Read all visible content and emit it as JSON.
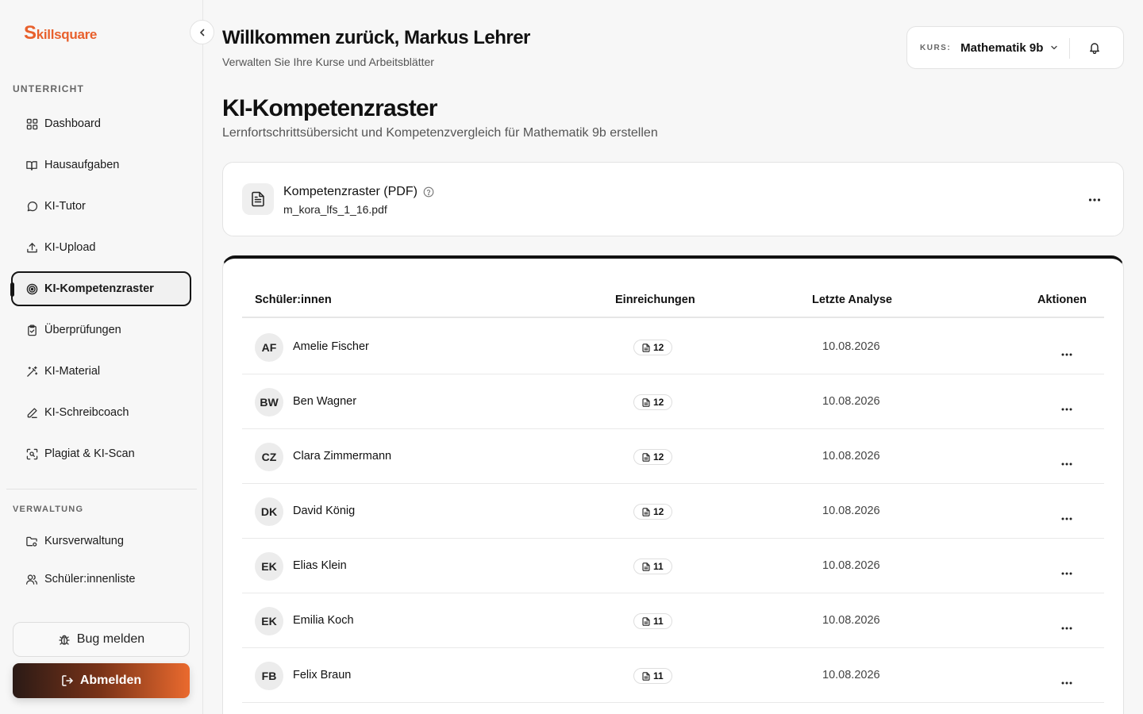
{
  "brand": {
    "logo_initial": "S",
    "logo_rest": "killsquare",
    "accent": "#e8602c"
  },
  "sidebar": {
    "section_teaching": "UNTERRICHT",
    "section_admin": "VERWALTUNG",
    "items": [
      {
        "label": "Dashboard",
        "icon": "grid-icon"
      },
      {
        "label": "Hausaufgaben",
        "icon": "book-open-icon"
      },
      {
        "label": "KI-Tutor",
        "icon": "message-circle-icon"
      },
      {
        "label": "KI-Upload",
        "icon": "upload-icon"
      },
      {
        "label": "KI-Kompetenzraster",
        "icon": "target-icon",
        "active": true
      },
      {
        "label": "Überprüfungen",
        "icon": "clipboard-check-icon"
      },
      {
        "label": "KI-Material",
        "icon": "magic-wand-icon"
      },
      {
        "label": "KI-Schreibcoach",
        "icon": "pencil-icon"
      },
      {
        "label": "Plagiat & KI-Scan",
        "icon": "scan-icon"
      }
    ],
    "admin_items": [
      {
        "label": "Kursverwaltung",
        "icon": "folder-settings-icon"
      },
      {
        "label": "Schüler:innenliste",
        "icon": "users-icon"
      }
    ],
    "bug_label": "Bug melden",
    "logout_label": "Abmelden"
  },
  "header": {
    "greeting": "Willkommen zurück, Markus Lehrer",
    "subtitle": "Verwalten Sie Ihre Kurse und Arbeitsblätter",
    "course_label": "KURS:",
    "course_value": "Mathematik 9b"
  },
  "page": {
    "title": "KI-Kompetenzraster",
    "subtitle": "Lernfortschrittsübersicht und Kompetenzvergleich für Mathematik 9b erstellen"
  },
  "pdf": {
    "title": "Kompetenzraster (PDF)",
    "filename": "m_kora_lfs_1_16.pdf"
  },
  "table": {
    "headers": {
      "students": "Schüler:innen",
      "submissions": "Einreichungen",
      "last_analysis": "Letzte Analyse",
      "actions": "Aktionen"
    },
    "rows": [
      {
        "initials": "AF",
        "name": "Amelie Fischer",
        "submissions": "12",
        "date": "10.08.2026"
      },
      {
        "initials": "BW",
        "name": "Ben Wagner",
        "submissions": "12",
        "date": "10.08.2026"
      },
      {
        "initials": "CZ",
        "name": "Clara Zimmermann",
        "submissions": "12",
        "date": "10.08.2026"
      },
      {
        "initials": "DK",
        "name": "David König",
        "submissions": "12",
        "date": "10.08.2026"
      },
      {
        "initials": "EK",
        "name": "Elias Klein",
        "submissions": "11",
        "date": "10.08.2026"
      },
      {
        "initials": "EK",
        "name": "Emilia Koch",
        "submissions": "11",
        "date": "10.08.2026"
      },
      {
        "initials": "FB",
        "name": "Felix Braun",
        "submissions": "11",
        "date": "10.08.2026"
      }
    ]
  }
}
